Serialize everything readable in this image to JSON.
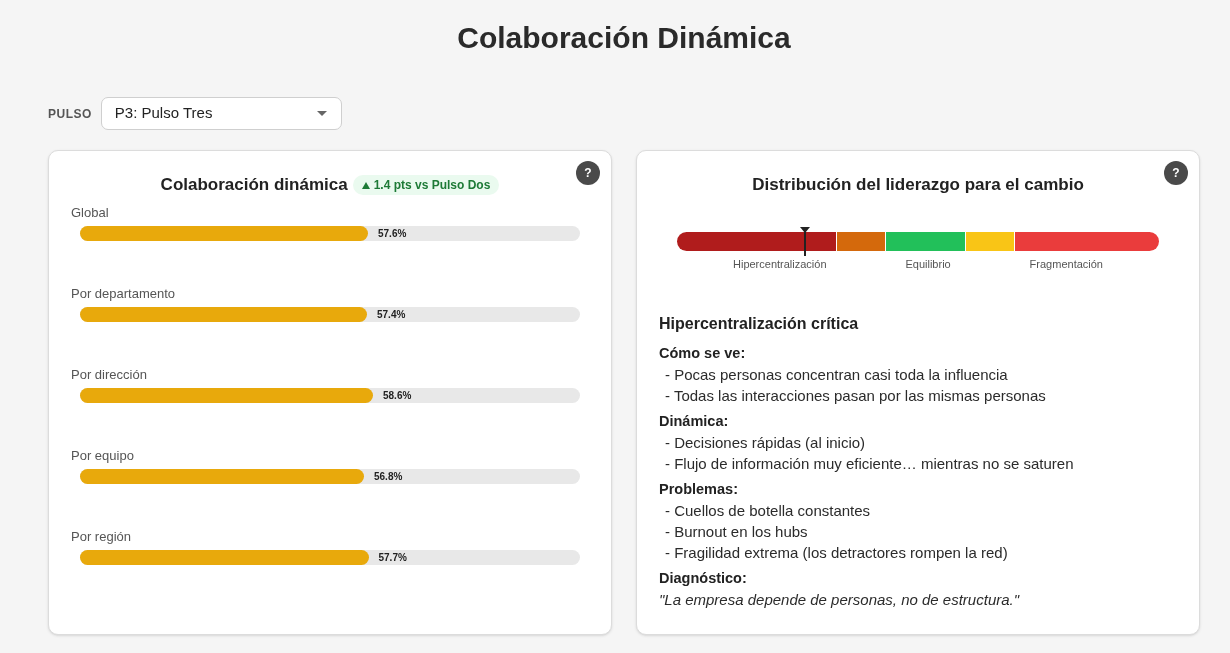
{
  "page": {
    "title": "Colaboración Dinámica"
  },
  "filter": {
    "label": "PULSO",
    "value": "P3: Pulso Tres"
  },
  "collaboration_card": {
    "title": "Colaboración dinámica",
    "help": "?",
    "change": {
      "positive": true,
      "text": "1.4 pts vs Pulso Dos"
    },
    "metrics": [
      {
        "label": "Global",
        "level": 0.576,
        "reading": "57.6%"
      },
      {
        "label": "Por departamento",
        "level": 0.574,
        "reading": "57.4%"
      },
      {
        "label": "Por dirección",
        "level": 0.586,
        "reading": "58.6%"
      },
      {
        "label": "Por equipo",
        "level": 0.568,
        "reading": "56.8%"
      },
      {
        "label": "Por región",
        "level": 0.577,
        "reading": "57.7%"
      }
    ]
  },
  "leadership_card": {
    "title": "Distribución del liderazgo para el cambio",
    "help": "?",
    "gauge": {
      "level": 0.265,
      "segments": [
        {
          "color": "#b01c1c"
        },
        {
          "color": "#d4690c"
        },
        {
          "color": "#22c05a"
        },
        {
          "color": "#f9c516"
        },
        {
          "color": "#ea3c3c"
        }
      ],
      "labels": [
        "Hipercentralización",
        "Equilibrio",
        "Fragmentación"
      ]
    },
    "diagnosis": {
      "title": "Hipercentralización crítica",
      "sections": [
        {
          "kind": "list",
          "heading": "Cómo se ve:",
          "items": [
            "- Pocas personas concentran casi toda la influencia",
            "- Todas las interacciones pasan por las mismas personas"
          ]
        },
        {
          "kind": "list",
          "heading": "Dinámica:",
          "items": [
            "- Decisiones rápidas (al inicio)",
            "- Flujo de información muy eficiente… mientras no se saturen"
          ]
        },
        {
          "kind": "list",
          "heading": "Problemas:",
          "items": [
            "- Cuellos de botella constantes",
            "- Burnout en los hubs",
            "- Fragilidad extrema (los detractores rompen la red)"
          ]
        },
        {
          "kind": "quote",
          "heading": "Diagnóstico:",
          "text": "\"La empresa depende de personas, no de estructura.\""
        }
      ]
    }
  }
}
